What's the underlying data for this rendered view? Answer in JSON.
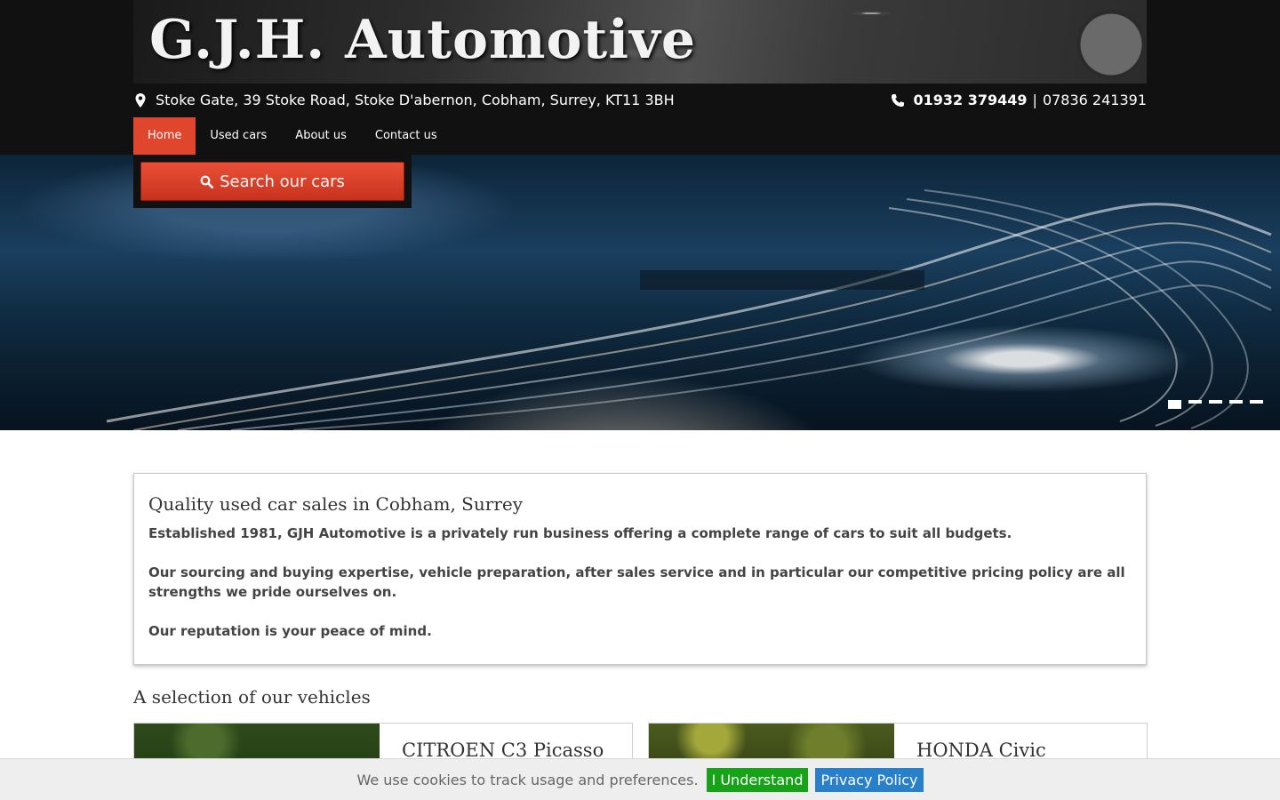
{
  "header": {
    "brand": "G.J.H. Automotive",
    "address": "Stoke Gate, 39 Stoke Road, Stoke D'abernon, Cobham, Surrey, KT11 3BH",
    "phone_primary": "01932 379449",
    "phone_separator": "|",
    "phone_secondary": "07836 241391",
    "icons": {
      "address": "map-pin-icon",
      "phone": "phone-icon"
    }
  },
  "nav": {
    "items": [
      {
        "label": "Home",
        "active": true
      },
      {
        "label": "Used cars",
        "active": false
      },
      {
        "label": "About us",
        "active": false
      },
      {
        "label": "Contact us",
        "active": false
      }
    ]
  },
  "search": {
    "button_label": "Search our cars",
    "icon": "search-icon"
  },
  "hero": {
    "slide_count": 5,
    "active_slide": 1
  },
  "about": {
    "title": "Quality used car sales in Cobham, Surrey",
    "paragraphs": [
      "Established 1981, GJH Automotive is a privately run business offering a complete range of cars to suit all budgets.",
      "Our sourcing and buying expertise, vehicle preparation, after sales service and in particular our competitive pricing policy are all strengths we pride ourselves on.",
      "Our reputation is your peace of mind."
    ]
  },
  "vehicles": {
    "section_title": "A selection of our vehicles",
    "items": [
      {
        "name": "CITROEN C3 Picasso"
      },
      {
        "name": "HONDA Civic"
      }
    ]
  },
  "cookie": {
    "message": "We use cookies to track usage and preferences.",
    "accept_label": "I Understand",
    "policy_label": "Privacy Policy"
  },
  "colors": {
    "accent": "#e0452d",
    "topbar": "#111111",
    "cookie_accept": "#16a317",
    "cookie_policy": "#2780c9"
  }
}
